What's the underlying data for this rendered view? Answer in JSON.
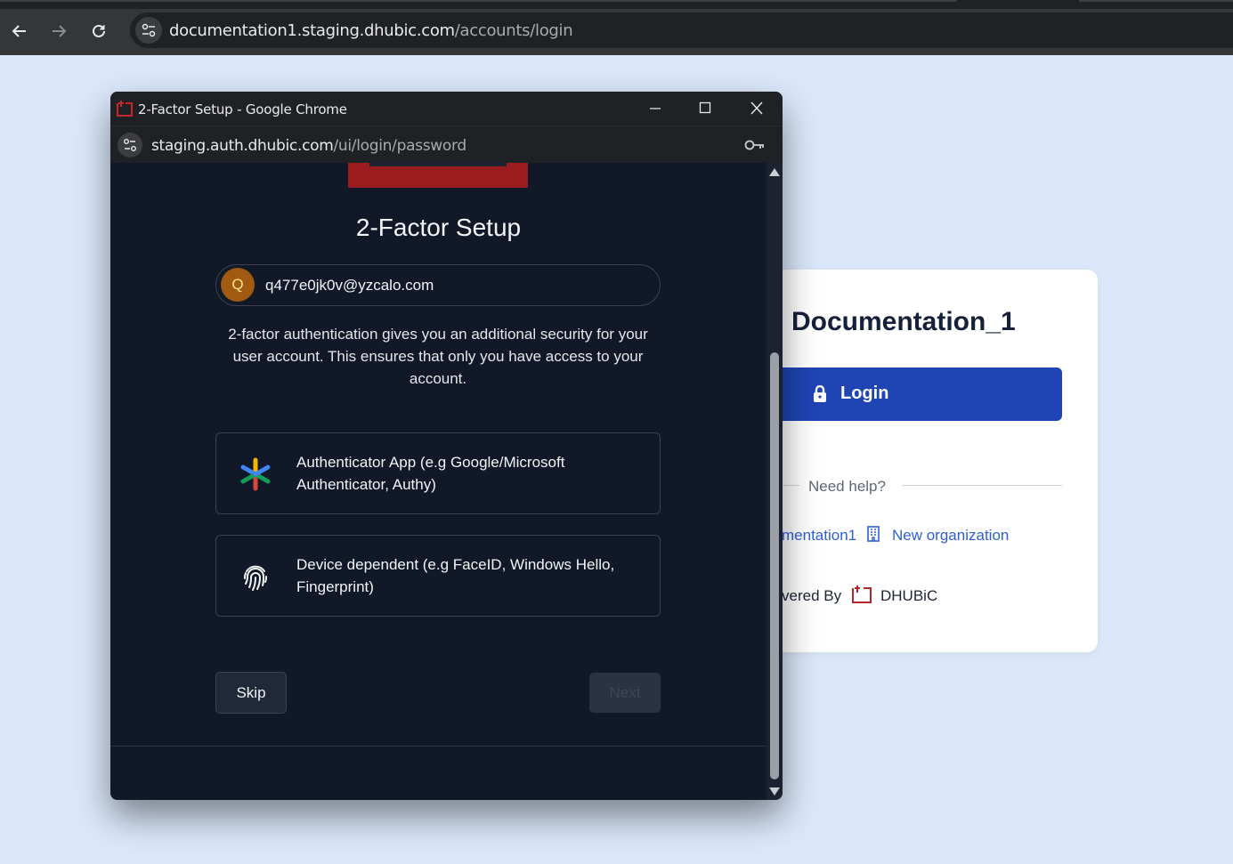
{
  "main_browser": {
    "url_host": "documentation1.staging.dhubic.com",
    "url_path": "/accounts/login",
    "back_icon": "arrow-left-icon",
    "forward_icon": "arrow-right-icon",
    "reload_icon": "reload-icon"
  },
  "login_card": {
    "org_title": "Documentation_1",
    "login_label": "Login",
    "need_help": "Need help?",
    "org_link": "mentation1",
    "new_org_link": "New organization",
    "powered_by": "vered By",
    "brand": "DHUBiC"
  },
  "popup": {
    "window_title": "2-Factor Setup - Google Chrome",
    "url_host": "staging.auth.dhubic.com",
    "url_path": "/ui/login/password",
    "heading": "2-Factor Setup",
    "avatar_initial": "Q",
    "email": "q477e0jk0v@yzcalo.com",
    "description": "2-factor authentication gives you an additional security for your user account. This ensures that only you have access to your account.",
    "options": [
      {
        "label": "Authenticator App (e.g Google/Microsoft Authenticator, Authy)",
        "icon": "authenticator-icon"
      },
      {
        "label": "Device dependent (e.g FaceID, Windows Hello, Fingerprint)",
        "icon": "fingerprint-icon"
      }
    ],
    "skip_label": "Skip",
    "next_label": "Next"
  },
  "colors": {
    "page_bg": "#dbe8fb",
    "login_button": "#1f44b3",
    "popup_bg": "#111827",
    "brand_red": "#9b1c1f",
    "link_blue": "#2d5fd4"
  }
}
